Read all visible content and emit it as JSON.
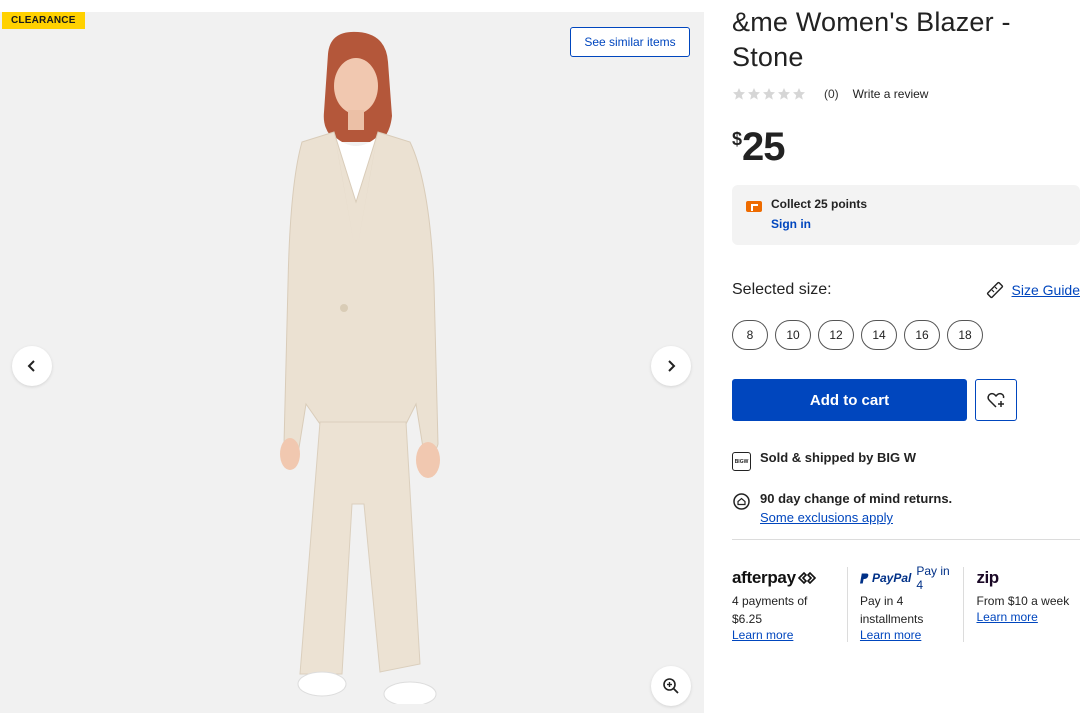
{
  "gallery": {
    "badge": "CLEARANCE",
    "similar_label": "See similar items",
    "prev_icon": "chevron-left-icon",
    "next_icon": "chevron-right-icon",
    "zoom_icon": "zoom-in-icon"
  },
  "product": {
    "title": "&me Women's Blazer - Stone",
    "review_count": "(0)",
    "write_review": "Write a review",
    "rating_stars": 0,
    "price_currency": "$",
    "price_amount": "25"
  },
  "rewards": {
    "text": "Collect 25 points",
    "signin": "Sign in"
  },
  "sizes": {
    "label": "Selected size:",
    "guide_label": "Size Guide",
    "options": [
      "8",
      "10",
      "12",
      "14",
      "16",
      "18"
    ]
  },
  "actions": {
    "add_to_cart": "Add to cart"
  },
  "shipping": {
    "sold_by": "Sold & shipped by BIG W",
    "icon_text": "BIGW",
    "returns": "90 day change of mind returns.",
    "exclusions": "Some exclusions apply"
  },
  "payments": [
    {
      "name": "afterpay",
      "text": "4 payments of $6.25",
      "link": "Learn more"
    },
    {
      "name": "PayPal",
      "tagline": "Pay in 4",
      "text": "Pay in 4 installments",
      "link": "Learn more"
    },
    {
      "name": "zip",
      "text": "From $10 a week",
      "link": "Learn more"
    }
  ],
  "colors": {
    "primary": "#0046be",
    "badge": "#ffd100",
    "rewards_icon": "#ee6b00"
  }
}
